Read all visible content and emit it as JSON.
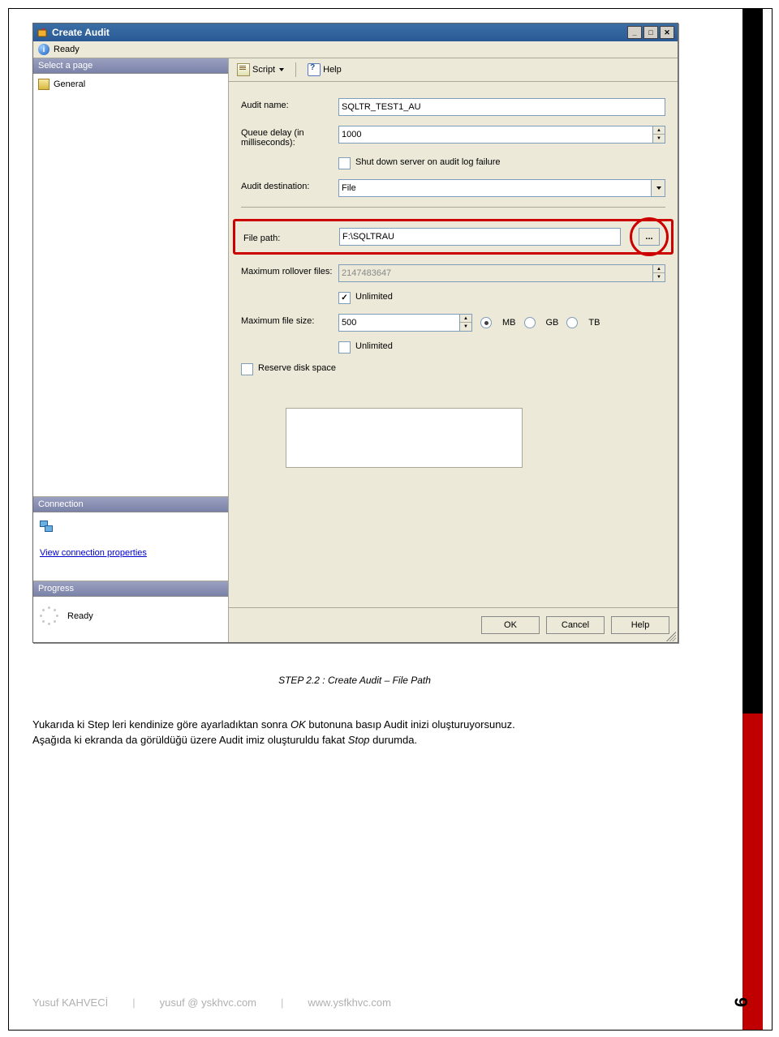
{
  "window": {
    "title": "Create Audit",
    "status": "Ready"
  },
  "sidebar": {
    "header": "Select a page",
    "items": [
      {
        "label": "General"
      }
    ],
    "connection": {
      "header": "Connection",
      "link": "View connection properties"
    },
    "progress": {
      "header": "Progress",
      "label": "Ready"
    }
  },
  "toolbar": {
    "script": "Script",
    "help": "Help"
  },
  "form": {
    "audit_name_label": "Audit name:",
    "audit_name_value": "SQLTR_TEST1_AU",
    "queue_delay_label": "Queue delay (in milliseconds):",
    "queue_delay_value": "1000",
    "shutdown_label": "Shut down server on audit log failure",
    "dest_label": "Audit destination:",
    "dest_value": "File",
    "filepath_label": "File path:",
    "filepath_value": "F:\\SQLTRAU",
    "browse_label": "...",
    "max_rollover_label": "Maximum rollover files:",
    "max_rollover_value": "2147483647",
    "unlimited1": "Unlimited",
    "max_file_label": "Maximum file size:",
    "max_file_value": "500",
    "size_mb": "MB",
    "size_gb": "GB",
    "size_tb": "TB",
    "unlimited2": "Unlimited",
    "reserve_label": "Reserve disk space"
  },
  "buttons": {
    "ok": "OK",
    "cancel": "Cancel",
    "help": "Help"
  },
  "caption": "STEP 2.2 : Create Audit – File Path",
  "para1_a": "Yukarıda ki Step leri kendinize göre ayarladıktan sonra ",
  "para1_ok": "OK",
  "para1_b": " butonuna basıp Audit inizi oluşturuyorsunuz.",
  "para2_a": "Aşağıda ki ekranda da görüldüğü üzere Audit imiz oluşturuldu fakat ",
  "para2_stop": "Stop",
  "para2_b": " durumda.",
  "footer": {
    "author": "Yusuf KAHVECİ",
    "email": "yusuf @ yskhvc.com",
    "site": "www.ysfkhvc.com",
    "page": "6"
  }
}
